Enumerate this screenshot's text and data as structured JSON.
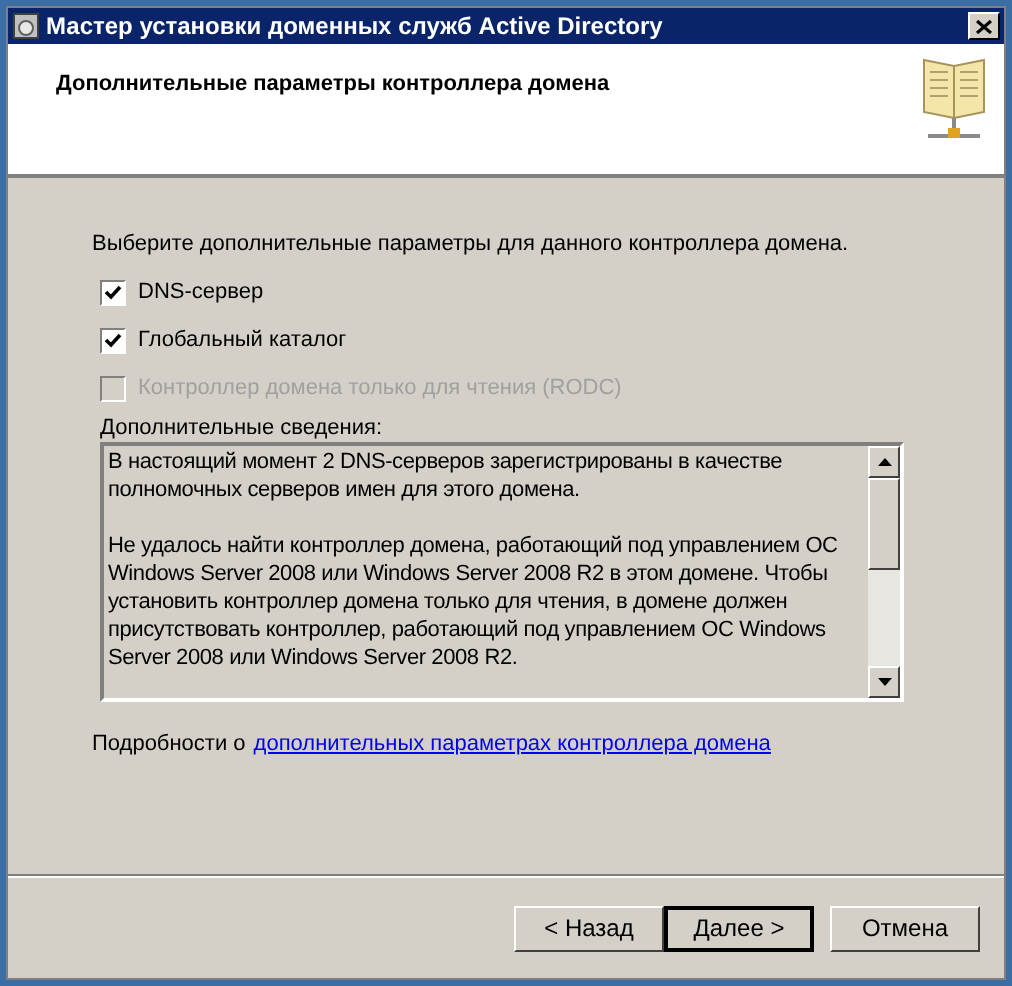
{
  "window": {
    "title": "Мастер установки доменных служб Active Directory"
  },
  "header": {
    "title": "Дополнительные параметры контроллера домена"
  },
  "prompt": "Выберите дополнительные параметры для данного контроллера домена.",
  "options": [
    {
      "label": "DNS-сервер",
      "checked": true,
      "disabled": false
    },
    {
      "label": "Глобальный каталог",
      "checked": true,
      "disabled": false
    },
    {
      "label": "Контроллер домена только для чтения (RODC)",
      "checked": false,
      "disabled": true
    }
  ],
  "details_label": "Дополнительные сведения:",
  "details": [
    "В настоящий момент 2 DNS-серверов зарегистрированы в качестве полномочных серверов имен для этого домена.",
    "Не удалось найти контроллер домена, работающий под управлением ОС Windows Server 2008 или Windows Server 2008 R2 в этом домене. Чтобы установить контроллер домена только для чтения, в домене должен присутствовать контроллер, работающий под управлением ОС Windows Server 2008 или Windows Server 2008 R2."
  ],
  "more": {
    "prefix": "Подробности о",
    "link": "дополнительных параметрах контроллера домена"
  },
  "buttons": [
    {
      "label": "< Назад",
      "default": false
    },
    {
      "label": "Далее >",
      "default": true
    },
    {
      "label": "Отмена",
      "default": false
    }
  ]
}
